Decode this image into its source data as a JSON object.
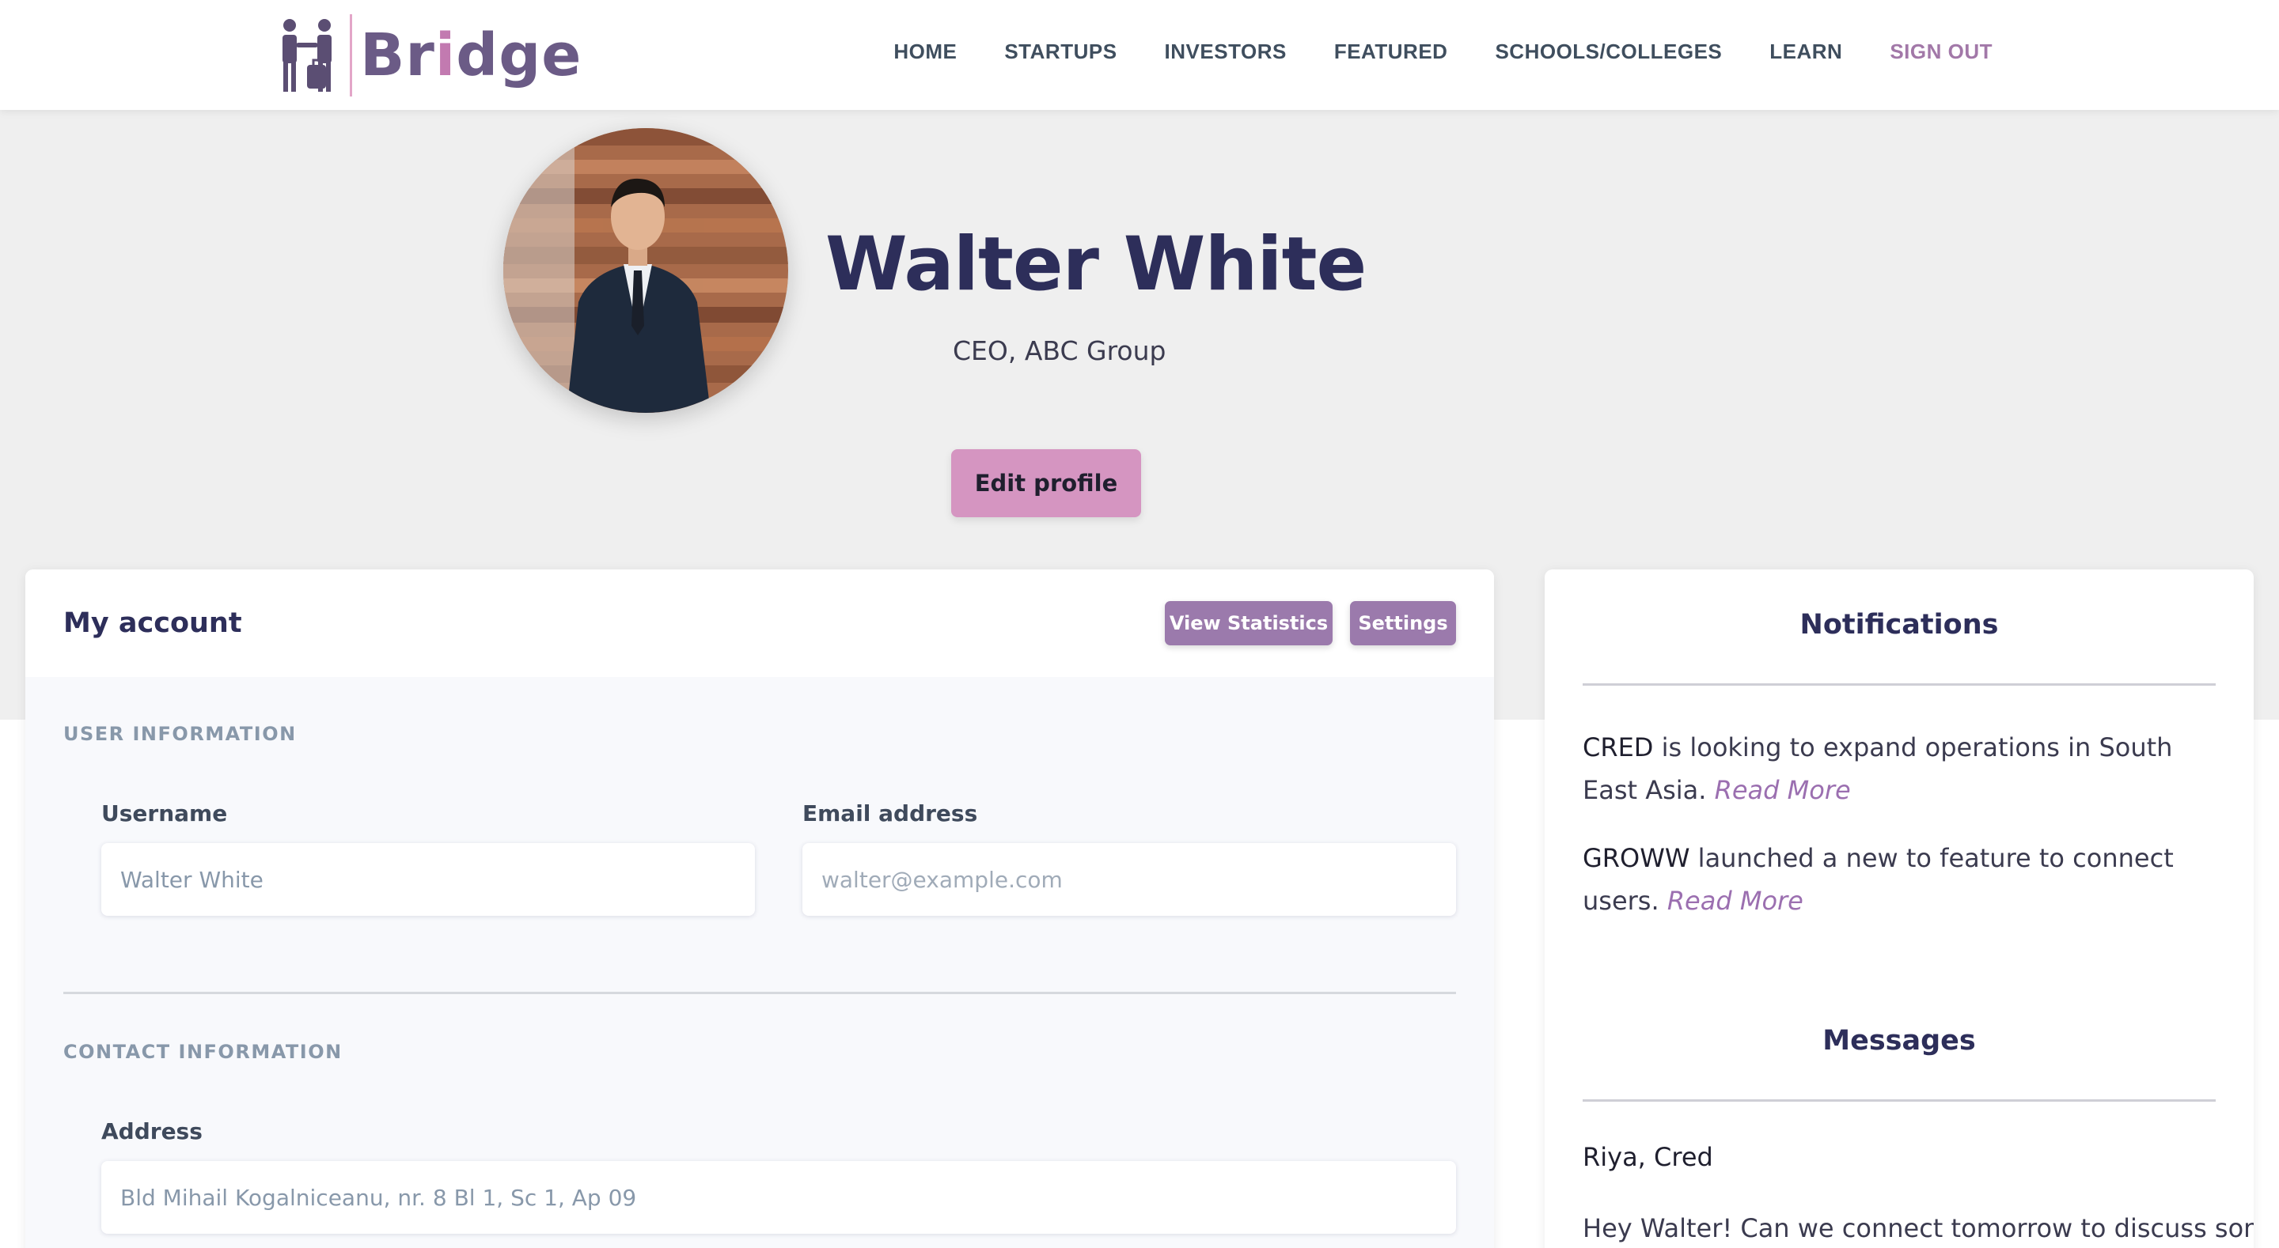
{
  "brand": {
    "name_prefix": "Br",
    "name_i": "i",
    "name_suffix": "dge"
  },
  "nav": {
    "items": [
      "HOME",
      "STARTUPS",
      "INVESTORS",
      "FEATURED",
      "SCHOOLS/COLLEGES",
      "LEARN"
    ],
    "signout": "SIGN OUT"
  },
  "profile": {
    "name": "Walter White",
    "title": "CEO, ABC Group",
    "edit_label": "Edit profile"
  },
  "account": {
    "title": "My account",
    "stats_label": "View Statistics",
    "settings_label": "Settings",
    "user_section": "USER INFORMATION",
    "username_label": "Username",
    "username_value": "Walter White",
    "email_label": "Email address",
    "email_placeholder": "walter@example.com",
    "contact_section": "CONTACT INFORMATION",
    "address_label": "Address",
    "address_value": "Bld Mihail Kogalniceanu, nr. 8 Bl 1, Sc 1, Ap 09"
  },
  "notifications": {
    "heading": "Notifications",
    "items": [
      {
        "company": "CRED",
        "text": " is looking to expand operations in South East Asia. ",
        "link": "Read More"
      },
      {
        "company": "GROWW",
        "text": " launched a new to feature to connect users. ",
        "link": "Read More"
      }
    ]
  },
  "messages": {
    "heading": "Messages",
    "sender": "Riya, Cred",
    "body": "Hey Walter! Can we connect tomorrow to discuss some"
  },
  "colors": {
    "brand": "#6b5b86",
    "accent_pink": "#d595c1",
    "button_purple": "#9b7aac",
    "link_purple": "#9b6fb0",
    "heading_navy": "#2d2e5a"
  }
}
